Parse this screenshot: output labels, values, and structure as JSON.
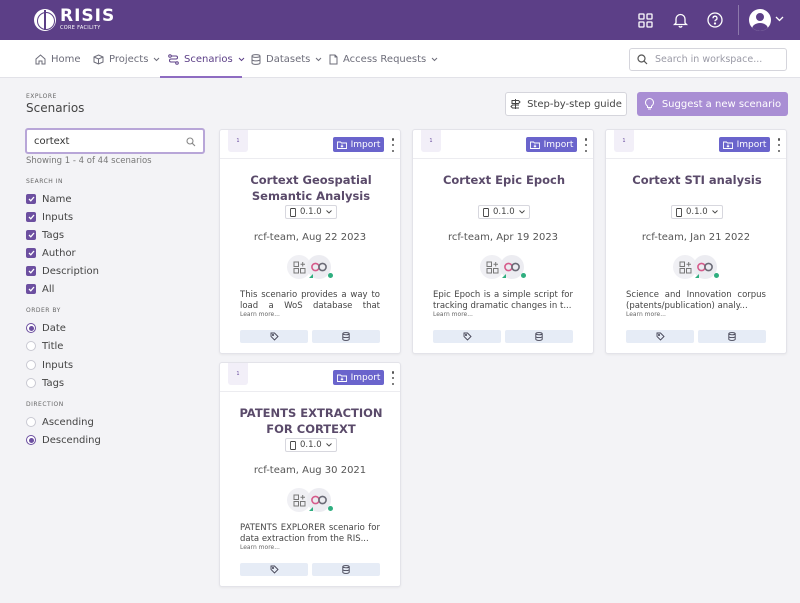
{
  "header": {
    "logo_main": "RISIS",
    "logo_sub": "CORE FACILITY"
  },
  "nav": {
    "items": [
      {
        "label": "Home"
      },
      {
        "label": "Projects"
      },
      {
        "label": "Scenarios"
      },
      {
        "label": "Datasets"
      },
      {
        "label": "Access Requests"
      }
    ],
    "search_placeholder": "Search in workspace..."
  },
  "left": {
    "eyebrow": "EXPLORE",
    "title": "Scenarios",
    "filter_value": "cortext",
    "showing": "Showing 1 - 4 of 44 scenarios",
    "search_in_label": "SEARCH IN",
    "search_in": [
      "Name",
      "Inputs",
      "Tags",
      "Author",
      "Description",
      "All"
    ],
    "order_by_label": "ORDER BY",
    "order_by": [
      "Date",
      "Title",
      "Inputs",
      "Tags"
    ],
    "order_by_selected": "Date",
    "direction_label": "DIRECTION",
    "direction": [
      "Ascending",
      "Descending"
    ],
    "direction_selected": "Descending"
  },
  "toolbar": {
    "guide_label": "Step-by-step guide",
    "suggest_label": "Suggest a new scenario"
  },
  "cards": [
    {
      "thumb": "1",
      "import_label": "Import",
      "title": "Cortext Geospatial Semantic Analysis",
      "version": "0.1.0",
      "meta": "rcf-team, Aug 22 2023",
      "desc": "This scenario provides a way to load a WoS database that contai...",
      "learn": "Learn more..."
    },
    {
      "thumb": "1",
      "import_label": "Import",
      "title": "Cortext Epic Epoch",
      "version": "0.1.0",
      "meta": "rcf-team, Apr 19 2023",
      "desc": "Epic Epoch is a simple script for tracking dramatic changes in t...",
      "learn": "Learn more..."
    },
    {
      "thumb": "1",
      "import_label": "Import",
      "title": "Cortext STI analysis",
      "version": "0.1.0",
      "meta": "rcf-team, Jan 21 2022",
      "desc": "Science and Innovation corpus (patents/publication) analy...",
      "learn": "Learn more..."
    },
    {
      "thumb": "1",
      "import_label": "Import",
      "title": "PATENTS EXTRACTION FOR CORTEXT",
      "version": "0.1.0",
      "meta": "rcf-team, Aug 30 2021",
      "desc": "PATENTS EXPLORER scenario for data extraction from the RIS...",
      "learn": "Learn more..."
    }
  ],
  "colors": {
    "header_bg": "#5c3f87",
    "accent": "#6c4fa0",
    "import_btn": "#6a64cc",
    "suggest_btn": "#a98ed4",
    "status_green": "#2fae7f"
  },
  "icons": [
    "apps-grid-icon",
    "bell-icon",
    "help-icon",
    "user-avatar",
    "home-icon",
    "cube-icon",
    "route-icon",
    "database-icon",
    "document-icon",
    "search-icon",
    "signpost-icon",
    "lightbulb-icon",
    "folder-import-icon",
    "tag-icon",
    "phone-icon"
  ]
}
